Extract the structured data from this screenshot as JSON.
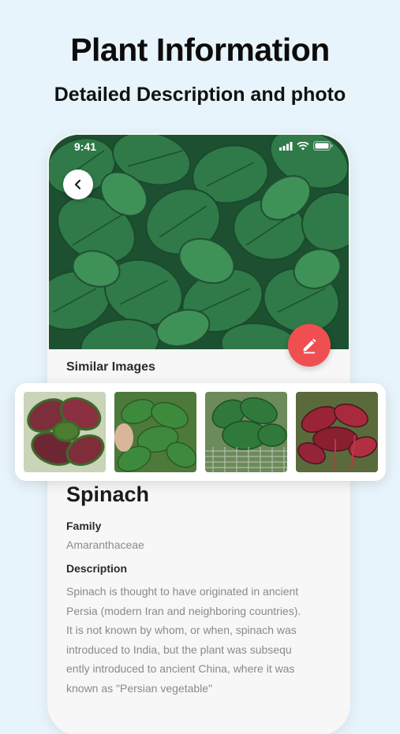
{
  "headline": "Plant Information",
  "subheadline": "Detailed Description and photo",
  "status_bar": {
    "time": "9:41"
  },
  "icons": {
    "back": "chevron-left-icon",
    "edit": "pencil-icon",
    "signal": "signal-icon",
    "wifi": "wifi-icon",
    "battery": "battery-icon"
  },
  "similar_images": {
    "title": "Similar Images",
    "items": [
      "red-green-amaranth-leaves",
      "spinach-bunch-in-hands",
      "spinach-in-wire-basket",
      "red-amaranth-plants"
    ]
  },
  "plant": {
    "name": "Spinach",
    "family_label": "Family",
    "family_value": "Amaranthaceae",
    "description_label": "Description",
    "description_lines": [
      "Spinach is thought to have originated in ancient",
      "Persia (modern Iran and neighboring countries).",
      "It is not known by whom, or when, spinach was",
      "introduced to India, but the plant was subsequ",
      "ently introduced to ancient China, where it was",
      "known as \"Persian vegetable\""
    ]
  },
  "colors": {
    "background": "#e8f4fb",
    "accent_fab": "#ef4f50",
    "leaf_dark": "#1f5a36",
    "leaf_light": "#3b8a55"
  }
}
